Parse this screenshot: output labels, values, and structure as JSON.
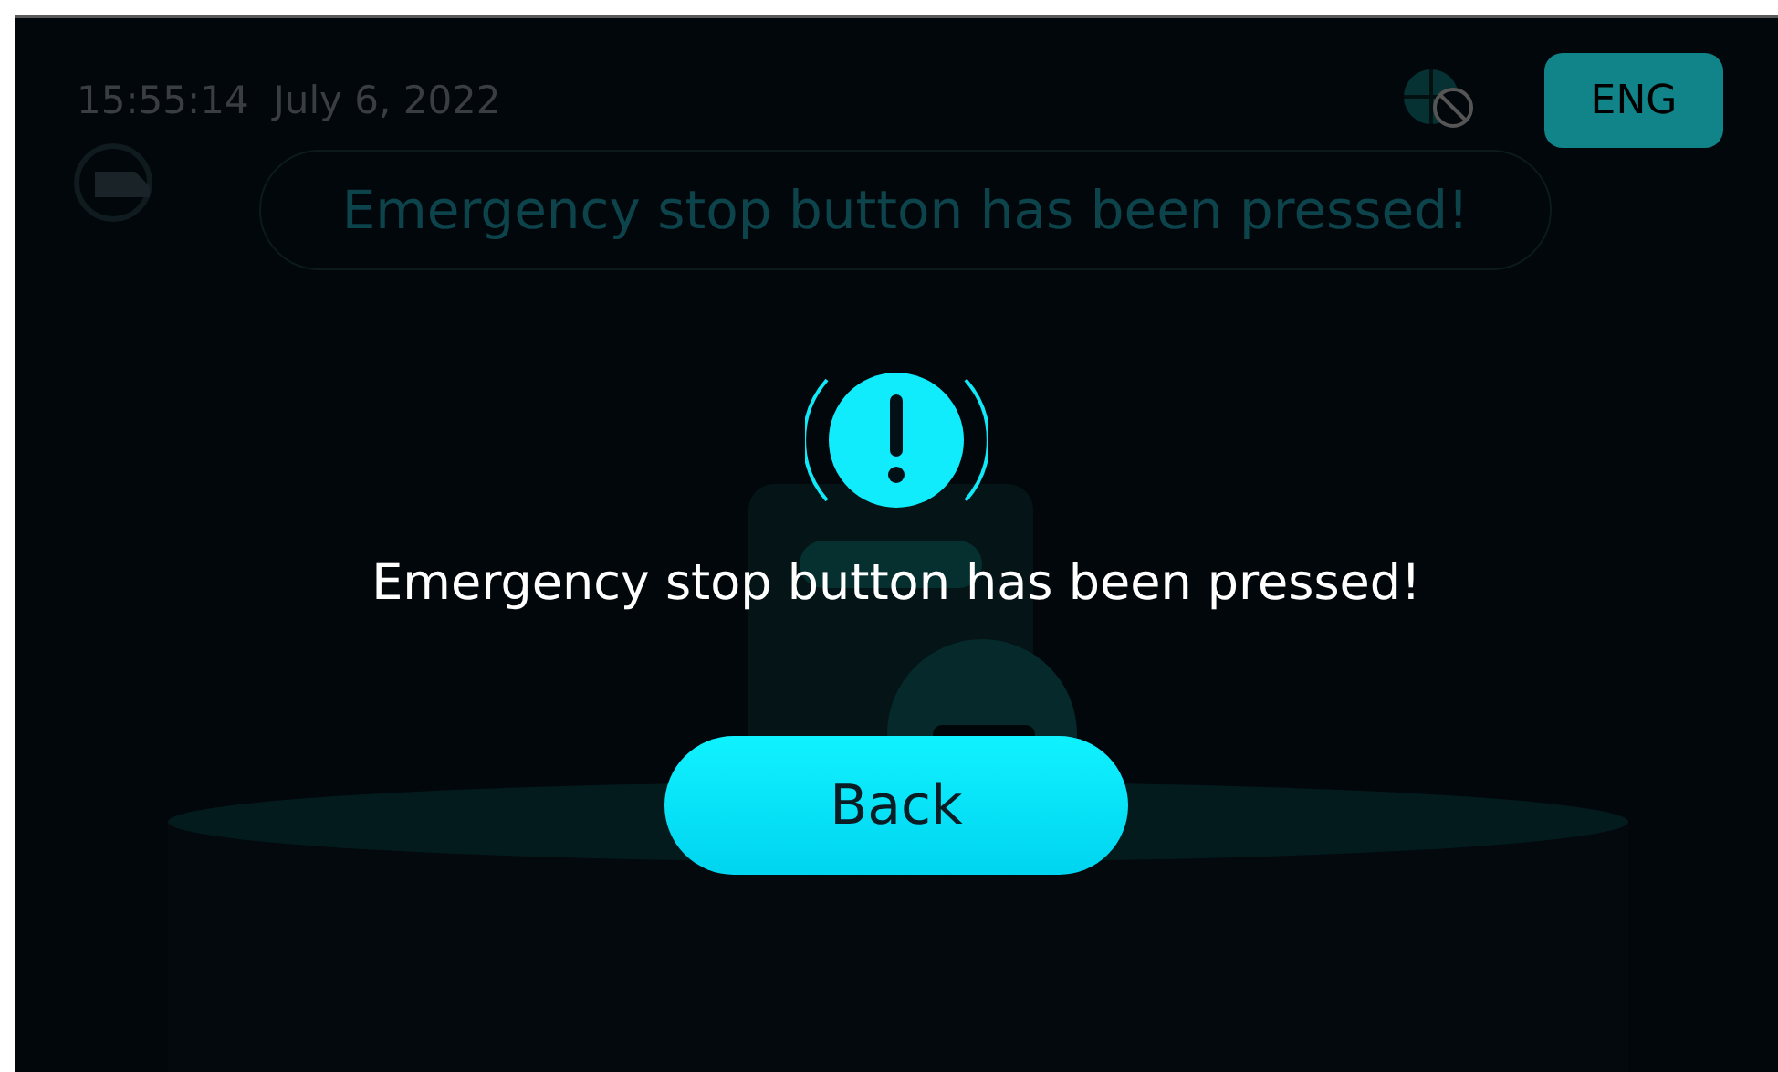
{
  "status_bar": {
    "time": "15:55:14",
    "date": "July 6, 2022",
    "language_button": "ENG"
  },
  "banner": {
    "text": "Emergency stop button has been pressed!"
  },
  "dialog": {
    "message": "Emergency stop button has been pressed!",
    "button": "Back"
  }
}
